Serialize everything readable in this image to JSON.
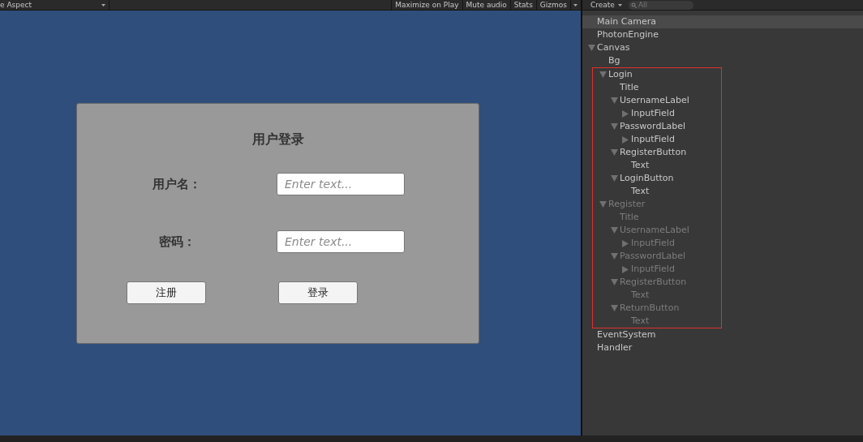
{
  "game_toolbar": {
    "aspect": "e Aspect",
    "buttons": [
      {
        "label": "Maximize on Play",
        "kind": "plain"
      },
      {
        "label": "Mute audio",
        "kind": "plain"
      },
      {
        "label": "Stats",
        "kind": "plain"
      },
      {
        "label": "Gizmos",
        "kind": "dropdown"
      }
    ]
  },
  "login_panel": {
    "title": "用户登录",
    "fields": [
      {
        "label": "用户名：",
        "placeholder": "Enter text..."
      },
      {
        "label": "密码：",
        "placeholder": "Enter text..."
      }
    ],
    "buttons": [
      "注册",
      "登录"
    ]
  },
  "hierarchy": {
    "create": "Create",
    "search_placeholder": "All",
    "items": [
      {
        "label": "Main Camera",
        "selected": true,
        "disabled": false
      },
      {
        "label": "PhotonEngine",
        "selected": false,
        "disabled": false
      },
      {
        "label": "Canvas",
        "selected": false,
        "disabled": false,
        "expanded": true,
        "children": [
          {
            "label": "Bg",
            "selected": false,
            "disabled": false
          },
          {
            "label": "Login",
            "selected": false,
            "disabled": false,
            "highlighted": true,
            "expanded": true,
            "children": [
              {
                "label": "Title",
                "selected": false,
                "disabled": false
              },
              {
                "label": "UsernameLabel",
                "selected": false,
                "disabled": false,
                "expanded": true,
                "children": [
                  {
                    "label": "InputField",
                    "selected": false,
                    "disabled": false,
                    "expanded": false
                  }
                ]
              },
              {
                "label": "PasswordLabel",
                "selected": false,
                "disabled": false,
                "expanded": true,
                "children": [
                  {
                    "label": "InputField",
                    "selected": false,
                    "disabled": false,
                    "expanded": false
                  }
                ]
              },
              {
                "label": "RegisterButton",
                "selected": false,
                "disabled": false,
                "expanded": true,
                "children": [
                  {
                    "label": "Text",
                    "selected": false,
                    "disabled": false
                  }
                ]
              },
              {
                "label": "LoginButton",
                "selected": false,
                "disabled": false,
                "expanded": true,
                "children": [
                  {
                    "label": "Text",
                    "selected": false,
                    "disabled": false
                  }
                ]
              }
            ]
          },
          {
            "label": "Register",
            "selected": false,
            "disabled": true,
            "highlighted": true,
            "expanded": true,
            "children": [
              {
                "label": "Title",
                "selected": false,
                "disabled": true
              },
              {
                "label": "UsernameLabel",
                "selected": false,
                "disabled": true,
                "expanded": true,
                "children": [
                  {
                    "label": "InputField",
                    "selected": false,
                    "disabled": true,
                    "expanded": false
                  }
                ]
              },
              {
                "label": "PasswordLabel",
                "selected": false,
                "disabled": true,
                "expanded": true,
                "children": [
                  {
                    "label": "InputField",
                    "selected": false,
                    "disabled": true,
                    "expanded": false
                  }
                ]
              },
              {
                "label": "RegisterButton",
                "selected": false,
                "disabled": true,
                "expanded": true,
                "children": [
                  {
                    "label": "Text",
                    "selected": false,
                    "disabled": true
                  }
                ]
              },
              {
                "label": "ReturnButton",
                "selected": false,
                "disabled": true,
                "expanded": true,
                "children": [
                  {
                    "label": "Text",
                    "selected": false,
                    "disabled": true
                  }
                ]
              }
            ]
          }
        ]
      },
      {
        "label": "EventSystem",
        "selected": false,
        "disabled": false
      },
      {
        "label": "Handler",
        "selected": false,
        "disabled": false
      }
    ]
  }
}
